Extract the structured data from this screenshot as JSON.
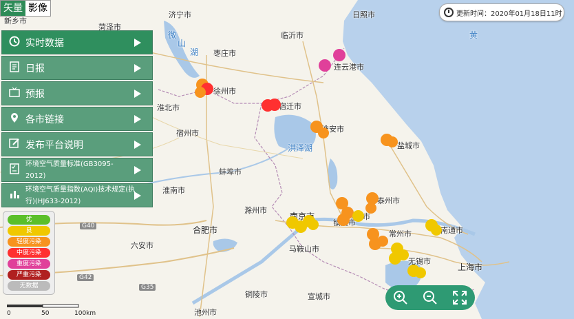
{
  "map_type_tabs": [
    {
      "label": "矢量",
      "active": true
    },
    {
      "label": "影像",
      "active": false
    }
  ],
  "menu": [
    {
      "label": "实时数据",
      "icon": "clock-icon"
    },
    {
      "label": "日报",
      "icon": "document-icon"
    },
    {
      "label": "预报",
      "icon": "tv-icon"
    },
    {
      "label": "各市链接",
      "icon": "location-pin-icon"
    },
    {
      "label": "发布平台说明",
      "icon": "edit-icon"
    },
    {
      "label": "环境空气质量标准(GB3095-2012)",
      "icon": "checklist-icon"
    },
    {
      "label": "环境空气质量指数(AQI)技术规定(执行)(HJ633-2012)",
      "icon": "bar-chart-icon"
    }
  ],
  "update_time": "更新时间：2020年01月18日11时",
  "legend": [
    {
      "label": "优",
      "color": "#5bbf2a"
    },
    {
      "label": "良",
      "color": "#f0c800"
    },
    {
      "label": "轻度污染",
      "color": "#f7931e"
    },
    {
      "label": "中度污染",
      "color": "#ff3030"
    },
    {
      "label": "重度污染",
      "color": "#e0409a"
    },
    {
      "label": "严重污染",
      "color": "#b02020"
    },
    {
      "label": "无数据",
      "color": "#bbbbbb"
    }
  ],
  "scale": {
    "labels": [
      "0",
      "50",
      "100km"
    ]
  },
  "map_labels": {
    "c1": "新乡市",
    "c2": "菏泽市",
    "c3": "济宁市",
    "c4": "日照市",
    "c5": "临沂市",
    "c6": "枣庄市",
    "c7": "连云港市",
    "c8": "徐州市",
    "c9": "淮北市",
    "c10": "宿迁市",
    "c11": "宿州市",
    "c12": "淮安市",
    "c13": "盐城市",
    "c14": "蚌埠市",
    "c15": "淮南市",
    "c16": "滁州市",
    "c17": "扬州市",
    "c18": "泰州市",
    "c19": "南京市",
    "c20": "镇江市",
    "c21": "合肥市",
    "c22": "常州市",
    "c23": "南通市",
    "c24": "六安市",
    "c25": "马鞍山市",
    "c26": "无锡市",
    "c27": "上海市",
    "c28": "铜陵市",
    "c29": "宣城市",
    "c30": "池州市",
    "w1": "黄",
    "w2": "微",
    "w3": "山",
    "w4": "湖",
    "w5": "洪泽湖",
    "r1": "G40",
    "r2": "G42",
    "r3": "G35"
  },
  "stations": {
    "lianyungang": {
      "level": "重度污染",
      "color": "#e0409a"
    },
    "suqian": {
      "level": "中度污染",
      "color": "#ff3030"
    },
    "xuzhou": {
      "level": "轻度污染/中度污染",
      "color": "#f7931e"
    },
    "huaian": {
      "level": "轻度污染",
      "color": "#f7931e"
    },
    "yancheng": {
      "level": "轻度污染",
      "color": "#f7931e"
    },
    "yangzhou": {
      "level": "轻度污染",
      "color": "#f7931e"
    },
    "taizhou": {
      "level": "轻度污染",
      "color": "#f7931e"
    },
    "nanjing": {
      "level": "良",
      "color": "#f0c800"
    },
    "zhenjiang": {
      "level": "轻度污染/良",
      "color": "#f7931e"
    },
    "changzhou": {
      "level": "轻度污染",
      "color": "#f7931e"
    },
    "wuxi": {
      "level": "良",
      "color": "#f0c800"
    },
    "nantong": {
      "level": "良",
      "color": "#f0c800"
    }
  }
}
